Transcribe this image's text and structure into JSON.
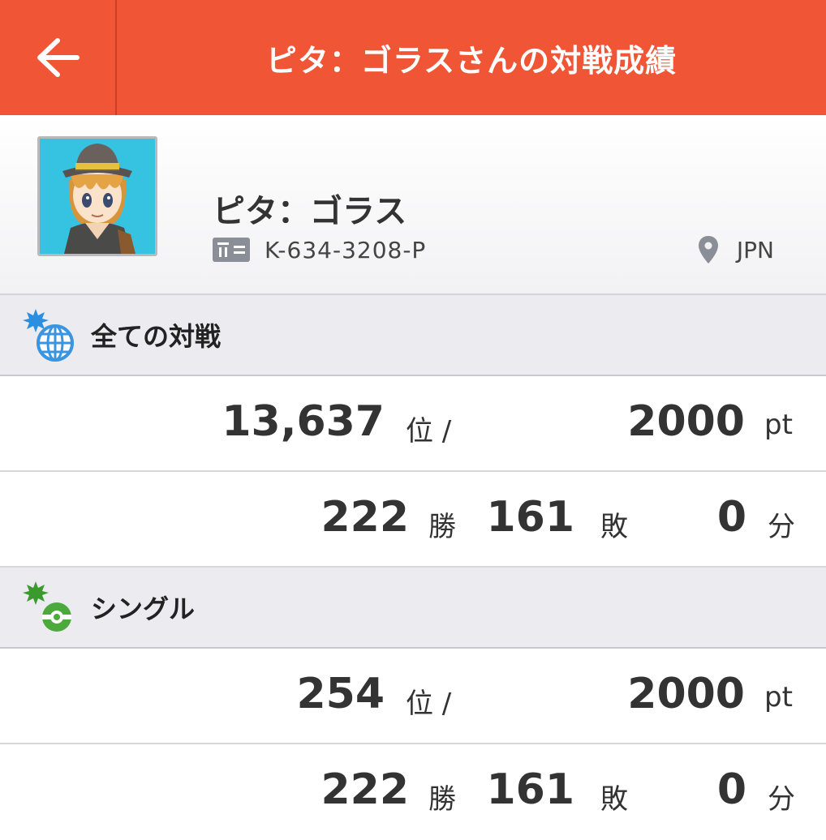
{
  "header": {
    "title": "ピタ：ゴラスさんの対戦成績",
    "back_icon": "arrow-left-icon",
    "color": "#f05535"
  },
  "profile": {
    "name": "ピタ：ゴラス",
    "id_icon": "id-card-icon",
    "player_id": "K-634-3208-P",
    "location_icon": "location-pin-icon",
    "country": "JPN"
  },
  "sections": [
    {
      "title": "全ての対戦",
      "icon": "globe-icon",
      "rank": "13,637",
      "rank_unit": "位 /",
      "points": "2000",
      "points_unit": "pt",
      "wins": "222",
      "wins_unit": "勝",
      "losses": "161",
      "losses_unit": "敗",
      "draws": "0",
      "draws_unit": "分"
    },
    {
      "title": "シングル",
      "icon": "single-battle-icon",
      "rank": "254",
      "rank_unit": "位 /",
      "points": "2000",
      "points_unit": "pt",
      "wins": "222",
      "wins_unit": "勝",
      "losses": "161",
      "losses_unit": "敗",
      "draws": "0",
      "draws_unit": "分"
    }
  ]
}
